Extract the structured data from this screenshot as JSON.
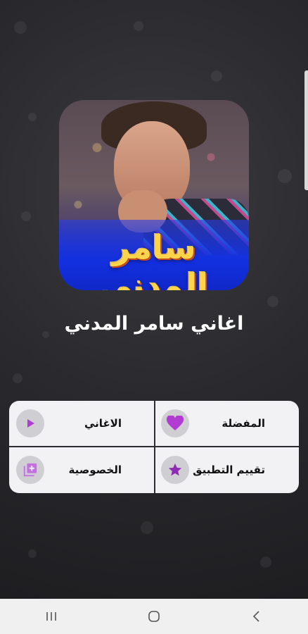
{
  "album": {
    "title_art": "سامر المدني"
  },
  "app": {
    "title": "اغاني سامر المدني"
  },
  "menu": {
    "items": [
      {
        "label": "المفضلة",
        "icon": "heart-icon"
      },
      {
        "label": "الاغاني",
        "icon": "play-icon"
      },
      {
        "label": "تقييم التطبيق",
        "icon": "star-icon"
      },
      {
        "label": "الخصوصية",
        "icon": "add-library-icon"
      }
    ]
  },
  "navbar": {
    "items": [
      "recent-apps-icon",
      "home-icon",
      "back-icon"
    ]
  },
  "colors": {
    "accent": "#8e2bb4",
    "menu_bg": "#f2f2f4",
    "icon_circle": "#cfcfd3",
    "album_title": "#ffd34a",
    "album_band": "#1230e0"
  }
}
